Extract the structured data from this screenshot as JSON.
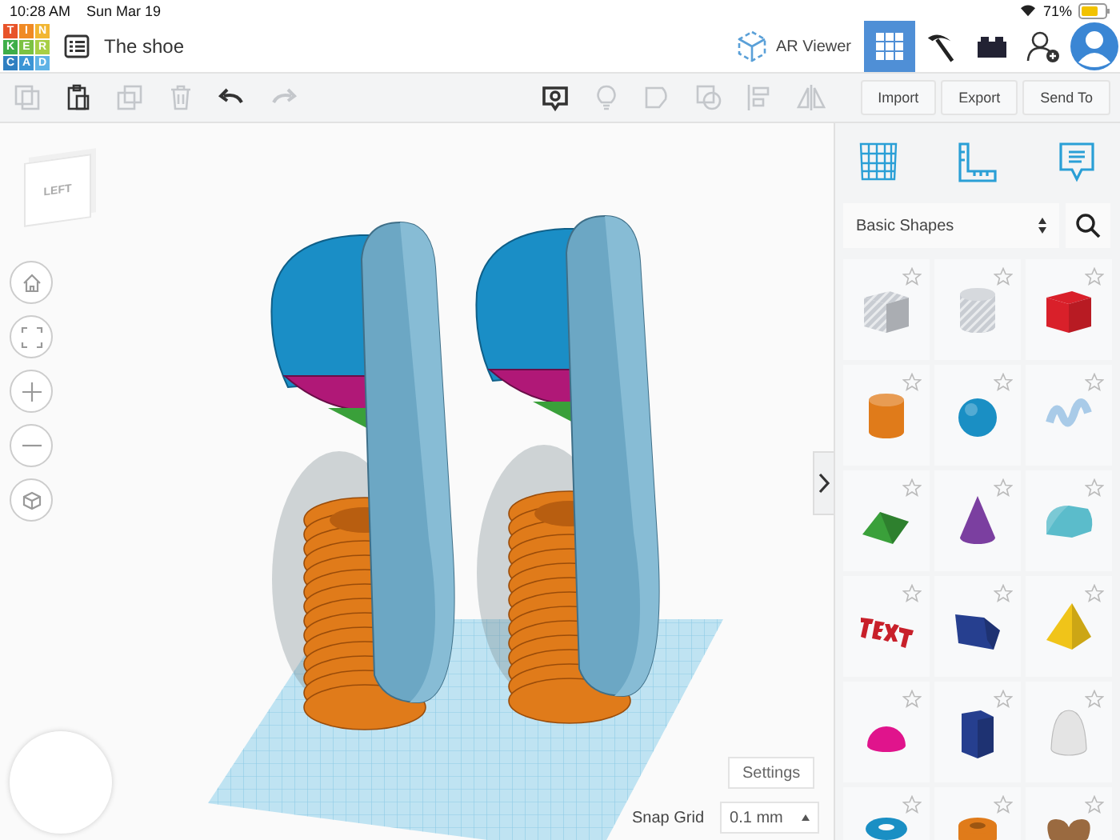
{
  "status_bar": {
    "time": "10:28 AM",
    "date": "Sun Mar 19",
    "battery": "71%"
  },
  "app_logo": {
    "letters": [
      {
        "text": "T",
        "color": "#e8542a"
      },
      {
        "text": "I",
        "color": "#f08a24"
      },
      {
        "text": "N",
        "color": "#f2b632"
      },
      {
        "text": "K",
        "color": "#3fae49"
      },
      {
        "text": "E",
        "color": "#7cc242"
      },
      {
        "text": "R",
        "color": "#a8cf45"
      },
      {
        "text": "C",
        "color": "#2f7fc1"
      },
      {
        "text": "A",
        "color": "#3b95d5"
      },
      {
        "text": "D",
        "color": "#5fb3e6"
      }
    ]
  },
  "document": {
    "title": "The shoe"
  },
  "top_actions": [
    {
      "kind": "ar",
      "label": "AR Viewer",
      "selected": false
    },
    {
      "kind": "grid",
      "selected": true
    },
    {
      "kind": "pickaxe",
      "selected": false
    },
    {
      "kind": "bricks",
      "selected": false
    },
    {
      "kind": "add-user",
      "selected": false
    },
    {
      "kind": "avatar",
      "selected": false
    }
  ],
  "toolbar": {
    "edit_tools": [
      {
        "kind": "copy",
        "disabled": true
      },
      {
        "kind": "paste",
        "disabled": false
      },
      {
        "kind": "duplicate",
        "disabled": true
      },
      {
        "kind": "delete",
        "disabled": true
      },
      {
        "kind": "undo",
        "disabled": false
      },
      {
        "kind": "redo",
        "disabled": true
      }
    ],
    "shape_tools": [
      {
        "kind": "notes",
        "disabled": false
      },
      {
        "kind": "bulb",
        "disabled": true
      },
      {
        "kind": "group",
        "disabled": true
      },
      {
        "kind": "ungroup",
        "disabled": true
      },
      {
        "kind": "align",
        "disabled": true
      },
      {
        "kind": "mirror",
        "disabled": true
      }
    ],
    "buttons": [
      "Import",
      "Export",
      "Send To"
    ]
  },
  "view_cube": {
    "face_label": "LEFT"
  },
  "view_controls": [
    {
      "kind": "home"
    },
    {
      "kind": "fit"
    },
    {
      "kind": "zoom-in"
    },
    {
      "kind": "zoom-out"
    },
    {
      "kind": "perspective"
    }
  ],
  "panel": {
    "tabs": [
      {
        "kind": "workplane"
      },
      {
        "kind": "ruler"
      },
      {
        "kind": "notes"
      }
    ],
    "library": "Basic Shapes",
    "shapes": [
      {
        "kind": "hole-box",
        "color": "#c8ccd2",
        "favorite": false
      },
      {
        "kind": "hole-cylinder",
        "color": "#c8ccd2",
        "favorite": false
      },
      {
        "kind": "box",
        "color": "#d9202a",
        "favorite": false
      },
      {
        "kind": "cylinder",
        "color": "#e07b1a",
        "favorite": false
      },
      {
        "kind": "sphere",
        "color": "#1a8fc4",
        "favorite": false
      },
      {
        "kind": "scribble",
        "color": "#a9cbe8",
        "favorite": false
      },
      {
        "kind": "roof",
        "color": "#3aa03a",
        "favorite": false
      },
      {
        "kind": "cone",
        "color": "#7b3fa0",
        "favorite": false
      },
      {
        "kind": "round-roof",
        "color": "#5bbccb",
        "favorite": false
      },
      {
        "kind": "text",
        "color": "#c8202a",
        "favorite": false
      },
      {
        "kind": "polygon",
        "color": "#263f8f",
        "favorite": false
      },
      {
        "kind": "pyramid",
        "color": "#f0c419",
        "favorite": false
      },
      {
        "kind": "half-sphere",
        "color": "#e0148c",
        "favorite": false
      },
      {
        "kind": "prism",
        "color": "#263f8f",
        "favorite": false
      },
      {
        "kind": "paraboloid",
        "color": "#e4e4e4",
        "favorite": false
      },
      {
        "kind": "torus",
        "color": "#1a8fc4",
        "favorite": false
      },
      {
        "kind": "tube",
        "color": "#e07b1a",
        "favorite": false
      },
      {
        "kind": "heart",
        "color": "#9a6a40",
        "favorite": false
      }
    ]
  },
  "settings_button": "Settings",
  "snap_grid": {
    "label": "Snap Grid",
    "value": "0.1 mm"
  }
}
